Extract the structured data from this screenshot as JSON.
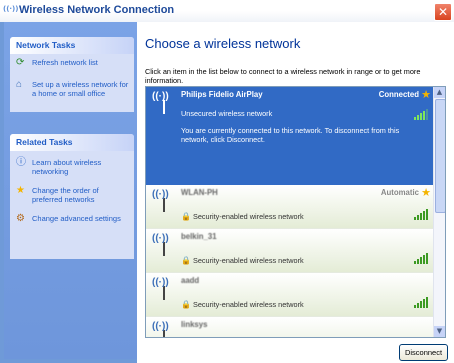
{
  "window": {
    "title": "Wireless Network Connection",
    "icon": "wireless-icon",
    "close": "✕"
  },
  "sidebar": {
    "network_tasks": {
      "title": "Network Tasks",
      "items": [
        {
          "label": "Refresh network list",
          "icon": "refresh-icon"
        },
        {
          "label": "Set up a wireless network for a home or small office",
          "icon": "setup-wireless-icon"
        }
      ]
    },
    "related_tasks": {
      "title": "Related Tasks",
      "items": [
        {
          "label": "Learn about wireless networking",
          "icon": "info-icon"
        },
        {
          "label": "Change the order of preferred networks",
          "icon": "star-icon"
        },
        {
          "label": "Change advanced settings",
          "icon": "settings-icon"
        }
      ]
    }
  },
  "main": {
    "heading": "Choose a wireless network",
    "instruction": "Click an item in the list below to connect to a wireless network in range or to get more information.",
    "networks": [
      {
        "ssid": "Philips Fidelio AirPlay",
        "status": "Connected",
        "security": "Unsecured wireless network",
        "description": "You are currently connected to this network. To disconnect from this network, click Disconnect.",
        "signal": 4,
        "connected": true
      },
      {
        "ssid": "WLAN-PH",
        "status": "Automatic",
        "security": "Security-enabled wireless network",
        "signal": 5,
        "connected": false
      },
      {
        "ssid": "belkin_31",
        "status": "",
        "security": "Security-enabled wireless network",
        "signal": 5,
        "connected": false
      },
      {
        "ssid": "aadd",
        "status": "",
        "security": "Security-enabled wireless network",
        "signal": 5,
        "connected": false
      },
      {
        "ssid": "linksys",
        "status": "",
        "security": "",
        "signal": 0,
        "connected": false
      }
    ],
    "disconnect_label": "Disconnect"
  },
  "colors": {
    "selection": "#316ac5",
    "link": "#215dc6",
    "heading": "#003399",
    "sidebar": "#6e96db"
  }
}
